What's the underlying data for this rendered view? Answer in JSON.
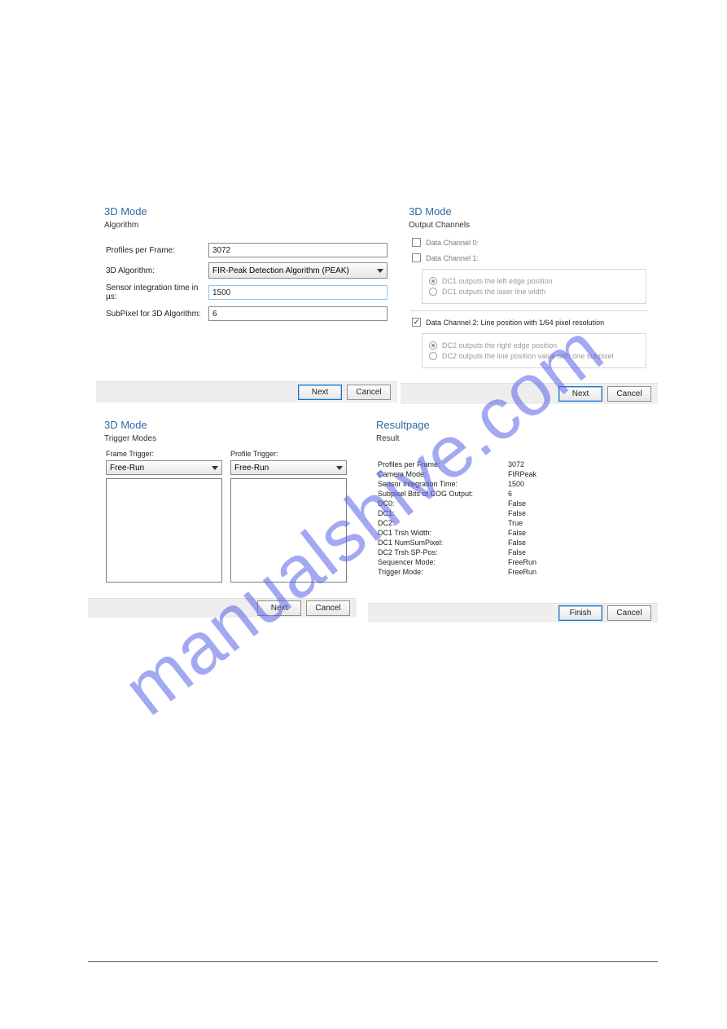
{
  "watermark": "manualshive.com",
  "panel1": {
    "title": "3D Mode",
    "section": "Algorithm",
    "profiles_label": "Profiles per Frame:",
    "profiles_value": "3072",
    "algo_label": "3D Algorithm:",
    "algo_value": "FIR-Peak Detection Algorithm (PEAK)",
    "integ_label": "Sensor integration time in µs:",
    "integ_value": "1500",
    "subpix_label": "SubPixel for 3D Algorithm:",
    "subpix_value": "6",
    "next": "Next",
    "cancel": "Cancel"
  },
  "panel2": {
    "title": "3D Mode",
    "section": "Output Channels",
    "dc0_label": "Data Channel 0:",
    "dc1_label": "Data Channel 1:",
    "dc1_opt1": "DC1 outputs the left edge position",
    "dc1_opt2": "DC1 outputs the laser line width",
    "dc2_label": "Data Channel 2:  Line position with 1/64 pixel resolution",
    "dc2_opt1": "DC2 outputs the right edge position",
    "dc2_opt2": "DC2 outputs the line position value with one subpixel",
    "next": "Next",
    "cancel": "Cancel"
  },
  "panel3": {
    "title": "3D Mode",
    "section": "Trigger Modes",
    "frame_label": "Frame Trigger:",
    "frame_value": "Free-Run",
    "profile_label": "Profile Trigger:",
    "profile_value": "Free-Run",
    "next": "Next",
    "cancel": "Cancel"
  },
  "panel4": {
    "title": "Resultpage",
    "section": "Result",
    "rows": [
      {
        "k": "Profiles per Frame:",
        "v": "3072"
      },
      {
        "k": "Camera Mode:",
        "v": "FIRPeak"
      },
      {
        "k": "Sensor Integration Time:",
        "v": "1500"
      },
      {
        "k": "Subpixel Bits of COG Output:",
        "v": "6"
      },
      {
        "k": "DC0:",
        "v": "False"
      },
      {
        "k": "DC1:",
        "v": "False"
      },
      {
        "k": "DC2:",
        "v": "True"
      },
      {
        "k": "DC1 Trsh Width:",
        "v": "False"
      },
      {
        "k": "DC1 NumSumPixel:",
        "v": "False"
      },
      {
        "k": "DC2 Trsh SP-Pos:",
        "v": "False"
      },
      {
        "k": "Sequencer Mode:",
        "v": "FreeRun"
      },
      {
        "k": "Trigger Mode:",
        "v": "FreeRun"
      }
    ],
    "finish": "Finish",
    "cancel": "Cancel"
  }
}
